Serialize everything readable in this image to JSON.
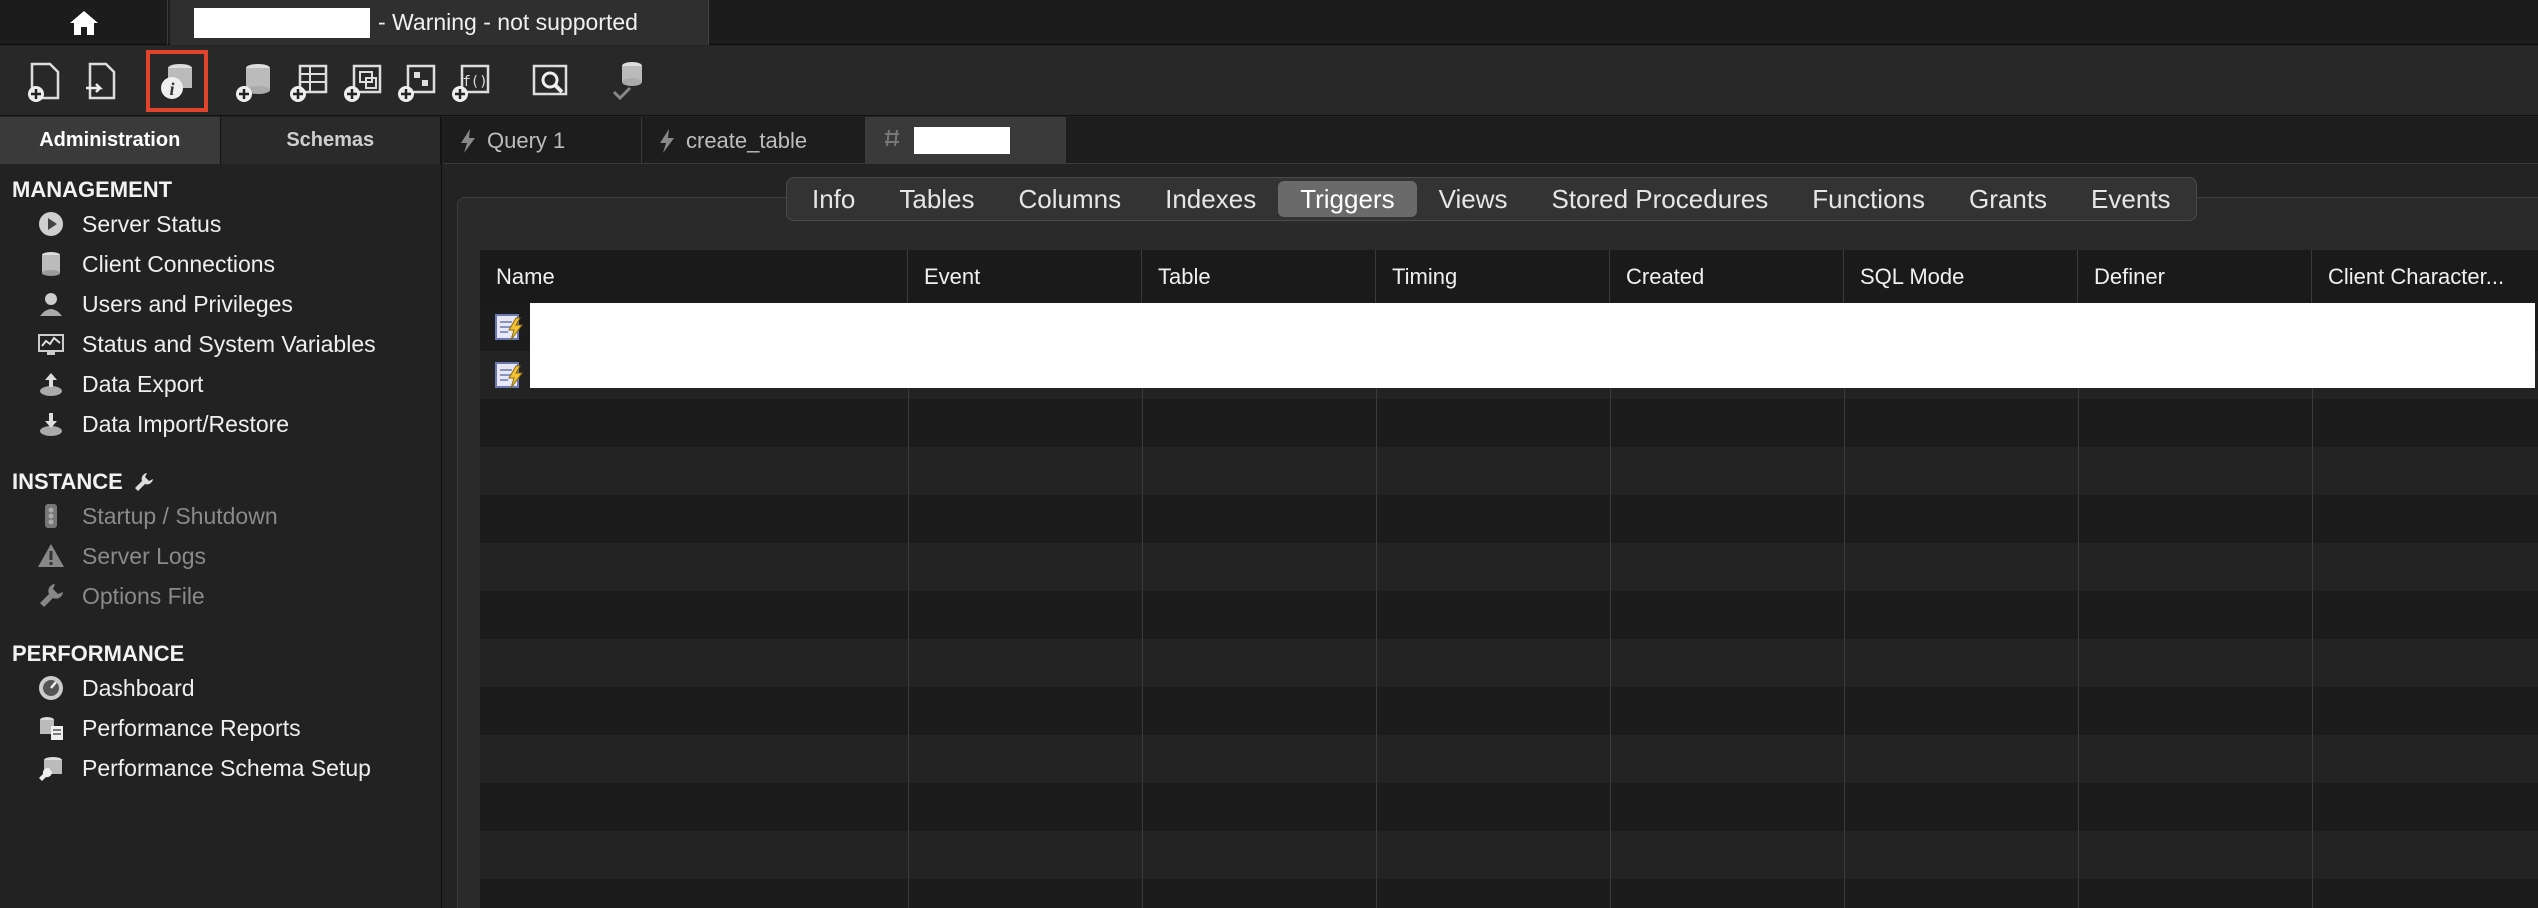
{
  "window": {
    "connection_tab_suffix": "- Warning - not supported"
  },
  "toolbar": {
    "icons": [
      "new-sql-tab-icon",
      "open-sql-script-icon",
      "schema-inspector-icon",
      "create-schema-icon",
      "create-table-icon",
      "create-view-icon",
      "create-procedure-icon",
      "create-function-icon",
      "search-table-data-icon",
      "reconnect-dbms-icon"
    ],
    "highlighted": "schema-inspector-icon"
  },
  "sidebar": {
    "tabs": [
      "Administration",
      "Schemas"
    ],
    "active_tab": "Administration",
    "management_title": "MANAGEMENT",
    "management_items": [
      {
        "label": "Server Status",
        "icon": "server-status-icon"
      },
      {
        "label": "Client Connections",
        "icon": "client-connections-icon"
      },
      {
        "label": "Users and Privileges",
        "icon": "users-icon"
      },
      {
        "label": "Status and System Variables",
        "icon": "system-variables-icon"
      },
      {
        "label": "Data Export",
        "icon": "data-export-icon"
      },
      {
        "label": "Data Import/Restore",
        "icon": "data-import-icon"
      }
    ],
    "instance_title": "INSTANCE",
    "instance_items": [
      {
        "label": "Startup / Shutdown",
        "icon": "startup-icon"
      },
      {
        "label": "Server Logs",
        "icon": "warning-icon"
      },
      {
        "label": "Options File",
        "icon": "wrench-icon"
      }
    ],
    "performance_title": "PERFORMANCE",
    "performance_items": [
      {
        "label": "Dashboard",
        "icon": "dashboard-icon"
      },
      {
        "label": "Performance Reports",
        "icon": "performance-reports-icon"
      },
      {
        "label": "Performance Schema Setup",
        "icon": "schema-setup-icon"
      }
    ]
  },
  "editor_tabs": [
    {
      "label": "Query 1",
      "icon": "bolt-icon"
    },
    {
      "label": "create_table",
      "icon": "bolt-icon"
    },
    {
      "label": "",
      "icon": "inspector-tab-icon"
    }
  ],
  "inspector": {
    "segments": [
      "Info",
      "Tables",
      "Columns",
      "Indexes",
      "Triggers",
      "Views",
      "Stored Procedures",
      "Functions",
      "Grants",
      "Events"
    ],
    "active_segment": "Triggers",
    "columns": [
      "Name",
      "Event",
      "Table",
      "Timing",
      "Created",
      "SQL Mode",
      "Definer",
      "Client Character..."
    ],
    "row_count_visible": 2
  },
  "colors": {
    "highlight": "#e0442b",
    "active_segment": "#6a6a6a"
  }
}
